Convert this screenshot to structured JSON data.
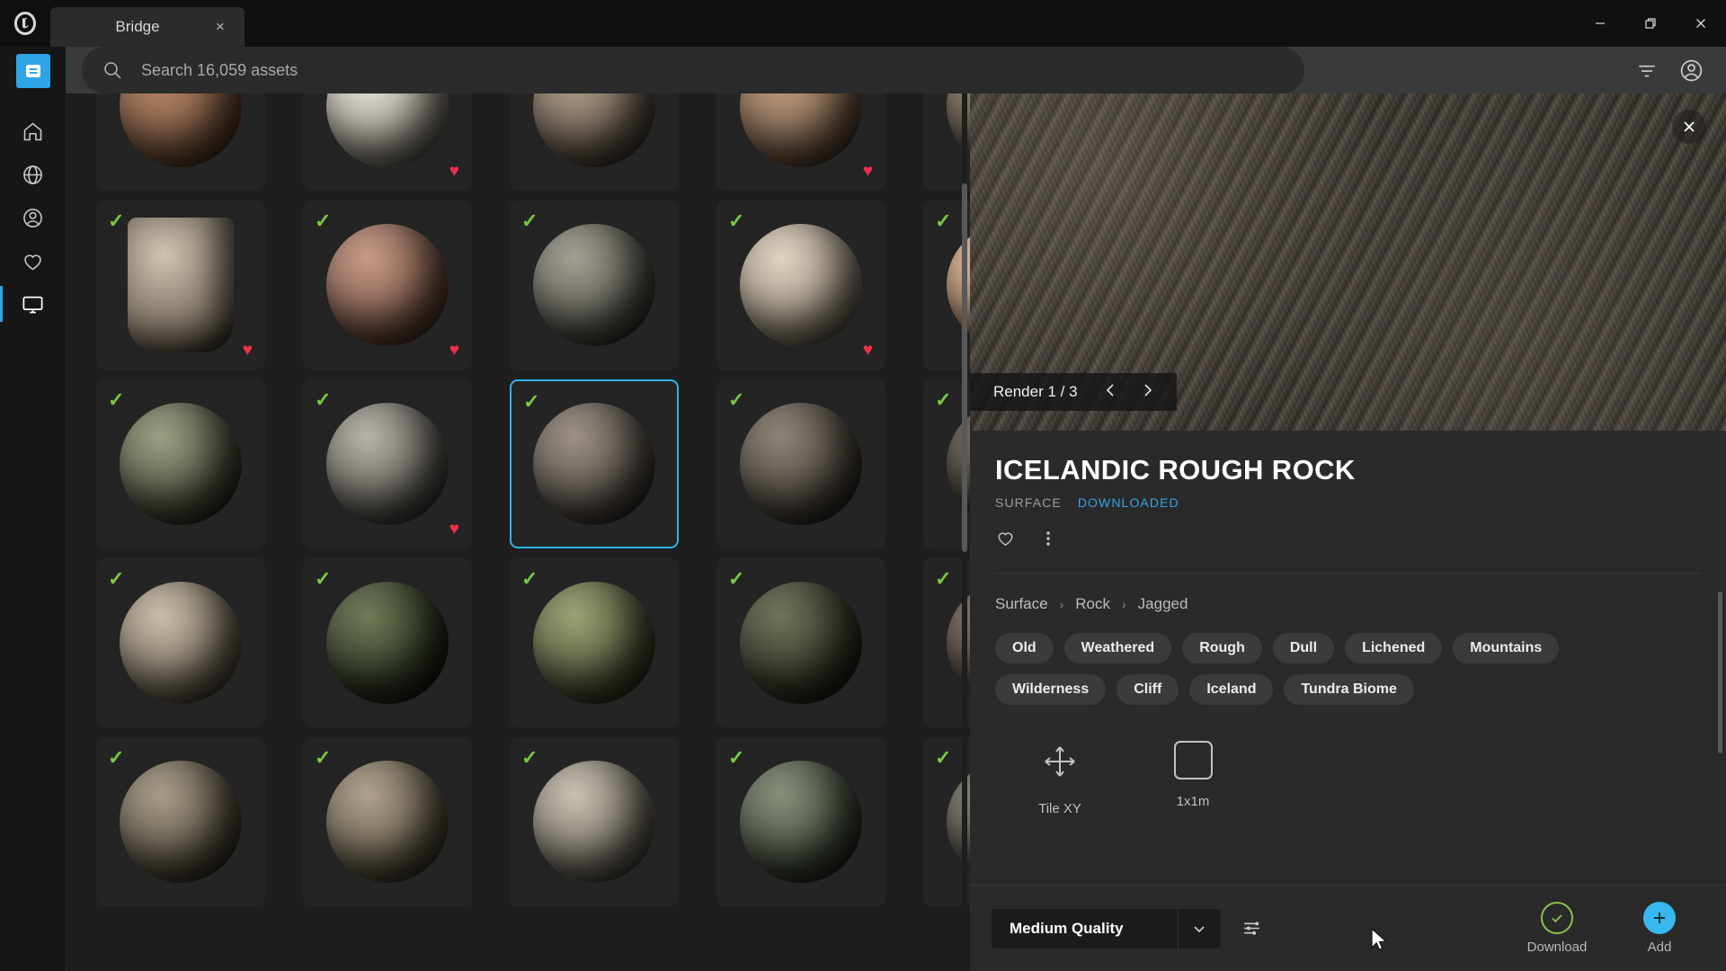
{
  "window": {
    "app_icon": "unreal-engine-logo",
    "tab_label": "Bridge",
    "tab_close": "×",
    "minimize": "—",
    "maximize": "❐",
    "close": "✕"
  },
  "rail": {
    "logo": "bridge-logo",
    "items": [
      {
        "icon": "home-icon",
        "name": "home"
      },
      {
        "icon": "globe-icon",
        "name": "browse"
      },
      {
        "icon": "account-icon",
        "name": "account"
      },
      {
        "icon": "heart-icon",
        "name": "favorites"
      },
      {
        "icon": "monitor-icon",
        "name": "local",
        "active": true
      }
    ]
  },
  "search": {
    "placeholder": "Search 16,059 assets",
    "value": "",
    "icon": "search-icon",
    "filter_icon": "filter-icon",
    "account_icon": "account-circle-icon"
  },
  "grid": {
    "rows": [
      [
        {
          "name": "asset-tile",
          "check": false,
          "heart": false,
          "shape": "sphere",
          "c1": "#b98a6b",
          "c2": "#6d4a35",
          "partial": true
        },
        {
          "name": "asset-tile",
          "check": false,
          "heart": true,
          "shape": "sphere",
          "c1": "#e9e5de",
          "c2": "#8e887d",
          "partial": true
        },
        {
          "name": "asset-tile",
          "check": false,
          "heart": false,
          "shape": "sphere",
          "c1": "#b2a08c",
          "c2": "#5d5144",
          "partial": true
        },
        {
          "name": "asset-tile",
          "check": false,
          "heart": true,
          "shape": "sphere",
          "c1": "#c2a184",
          "c2": "#6f5440",
          "partial": true
        },
        {
          "name": "asset-tile",
          "check": false,
          "heart": false,
          "shape": "sphere",
          "c1": "#9d8f7c",
          "c2": "#4e463a",
          "partial": true
        }
      ],
      [
        {
          "name": "asset-tile",
          "check": true,
          "heart": true,
          "shape": "vase",
          "c1": "#cfc3b0",
          "c2": "#6e6456"
        },
        {
          "name": "asset-tile",
          "check": true,
          "heart": true,
          "shape": "sphere",
          "c1": "#c89a85",
          "c2": "#6b4a3c"
        },
        {
          "name": "asset-tile",
          "check": true,
          "heart": false,
          "shape": "sphere",
          "c1": "#a3a195",
          "c2": "#4b4a43"
        },
        {
          "name": "asset-tile",
          "check": true,
          "heart": true,
          "shape": "sphere",
          "c1": "#ded2c0",
          "c2": "#8d8271"
        },
        {
          "name": "asset-tile",
          "check": true,
          "heart": true,
          "shape": "sphere",
          "c1": "#e0bfa4",
          "c2": "#9a7558"
        }
      ],
      [
        {
          "name": "asset-tile",
          "check": true,
          "heart": false,
          "shape": "sphere",
          "c1": "#9aa082",
          "c2": "#3f4434"
        },
        {
          "name": "asset-tile",
          "check": true,
          "heart": true,
          "shape": "sphere",
          "c1": "#b7b3aa",
          "c2": "#55524c"
        },
        {
          "name": "asset-tile",
          "check": true,
          "heart": false,
          "shape": "sphere",
          "c1": "#9b9085",
          "c2": "#4a443d",
          "selected": true
        },
        {
          "name": "asset-tile",
          "check": true,
          "heart": false,
          "shape": "sphere",
          "c1": "#8d8376",
          "c2": "#403a33"
        },
        {
          "name": "asset-tile",
          "check": true,
          "heart": false,
          "shape": "sphere",
          "c1": "#7e7363",
          "c2": "#2e2a23"
        }
      ],
      [
        {
          "name": "asset-tile",
          "check": true,
          "heart": false,
          "shape": "sphere",
          "c1": "#c9bda8",
          "c2": "#6b6253"
        },
        {
          "name": "asset-tile",
          "check": true,
          "heart": false,
          "shape": "sphere",
          "c1": "#6f7a55",
          "c2": "#232a1c"
        },
        {
          "name": "asset-tile",
          "check": true,
          "heart": false,
          "shape": "sphere",
          "c1": "#9aa274",
          "c2": "#44462e"
        },
        {
          "name": "asset-tile",
          "check": true,
          "heart": false,
          "shape": "sphere",
          "c1": "#6d7457",
          "c2": "#2a2d21"
        },
        {
          "name": "asset-tile",
          "check": true,
          "heart": false,
          "shape": "sphere",
          "c1": "#8d7a6c",
          "c2": "#3d332c"
        }
      ],
      [
        {
          "name": "asset-tile",
          "check": true,
          "heart": false,
          "shape": "sphere",
          "c1": "#a79c88",
          "c2": "#4f4839"
        },
        {
          "name": "asset-tile",
          "check": true,
          "heart": false,
          "shape": "sphere",
          "c1": "#b0a28c",
          "c2": "#57503f"
        },
        {
          "name": "asset-tile",
          "check": true,
          "heart": false,
          "shape": "sphere",
          "c1": "#c8c0b0",
          "c2": "#6a655a"
        },
        {
          "name": "asset-tile",
          "check": true,
          "heart": false,
          "shape": "sphere",
          "c1": "#85907a",
          "c2": "#353c30"
        },
        {
          "name": "asset-tile",
          "check": true,
          "heart": false,
          "shape": "sphere",
          "c1": "#8f8b7e",
          "c2": "#3e3b33"
        }
      ]
    ]
  },
  "detail": {
    "close_icon": "close-icon",
    "render_label": "Render 1 / 3",
    "prev_icon": "chevron-left-icon",
    "next_icon": "chevron-right-icon",
    "title": "ICELANDIC ROUGH ROCK",
    "type": "SURFACE",
    "status": "DOWNLOADED",
    "favorite_icon": "heart-outline-icon",
    "more_icon": "more-vertical-icon",
    "breadcrumb": [
      "Surface",
      "Rock",
      "Jagged"
    ],
    "breadcrumb_sep": "›",
    "tags": [
      "Old",
      "Weathered",
      "Rough",
      "Dull",
      "Lichened",
      "Mountains",
      "Wilderness",
      "Cliff",
      "Iceland",
      "Tundra Biome"
    ],
    "properties": [
      {
        "icon": "tile-xy-icon",
        "label": "Tile XY"
      },
      {
        "icon": "square-icon",
        "label": "1x1m"
      }
    ],
    "quality_value": "Medium Quality",
    "quality_caret": "chevron-down-icon",
    "settings_icon": "sliders-icon",
    "download_label": "Download",
    "download_icon": "check-circle-icon",
    "add_label": "Add",
    "add_icon": "plus-icon",
    "accent_blue": "#39b7ef",
    "accent_green": "#8bc34a",
    "selected_border": "#2fb3ec"
  }
}
